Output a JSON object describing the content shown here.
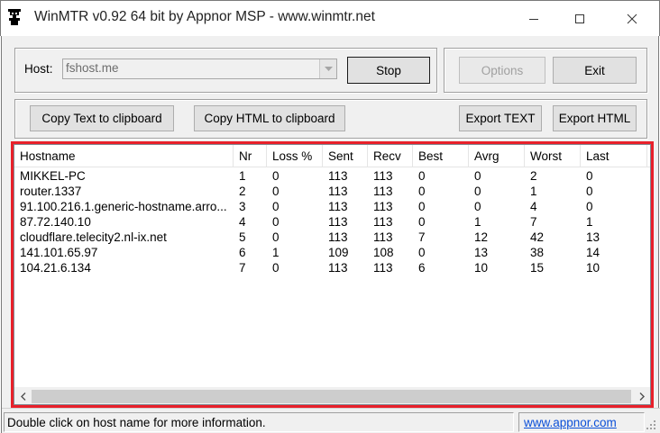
{
  "window": {
    "title": "WinMTR v0.92 64 bit by Appnor MSP - www.winmtr.net",
    "controls": {
      "minimize": "—",
      "maximize": "☐",
      "close": "✕"
    }
  },
  "host": {
    "label": "Host:",
    "value": "fshost.me",
    "dropdown_icon": "chevron-down-icon"
  },
  "buttons": {
    "stop": "Stop",
    "options": "Options",
    "exit": "Exit",
    "copy_text": "Copy Text to clipboard",
    "copy_html": "Copy HTML to clipboard",
    "export_text": "Export TEXT",
    "export_html": "Export HTML"
  },
  "table": {
    "columns": [
      "Hostname",
      "Nr",
      "Loss %",
      "Sent",
      "Recv",
      "Best",
      "Avrg",
      "Worst",
      "Last"
    ],
    "rows": [
      [
        "MIKKEL-PC",
        "1",
        "0",
        "113",
        "113",
        "0",
        "0",
        "2",
        "0"
      ],
      [
        "router.1337",
        "2",
        "0",
        "113",
        "113",
        "0",
        "0",
        "1",
        "0"
      ],
      [
        "91.100.216.1.generic-hostname.arro...",
        "3",
        "0",
        "113",
        "113",
        "0",
        "0",
        "4",
        "0"
      ],
      [
        "87.72.140.10",
        "4",
        "0",
        "113",
        "113",
        "0",
        "1",
        "7",
        "1"
      ],
      [
        "cloudflare.telecity2.nl-ix.net",
        "5",
        "0",
        "113",
        "113",
        "7",
        "12",
        "42",
        "13"
      ],
      [
        "141.101.65.97",
        "6",
        "1",
        "109",
        "108",
        "0",
        "13",
        "38",
        "14"
      ],
      [
        "104.21.6.134",
        "7",
        "0",
        "113",
        "113",
        "6",
        "10",
        "15",
        "10"
      ]
    ],
    "scroll_left": "<",
    "scroll_right": ">"
  },
  "status": {
    "message": "Double click on host name for more information.",
    "link": "www.appnor.com"
  },
  "colors": {
    "highlight": "#e8202a",
    "link": "#0a4fd8"
  }
}
